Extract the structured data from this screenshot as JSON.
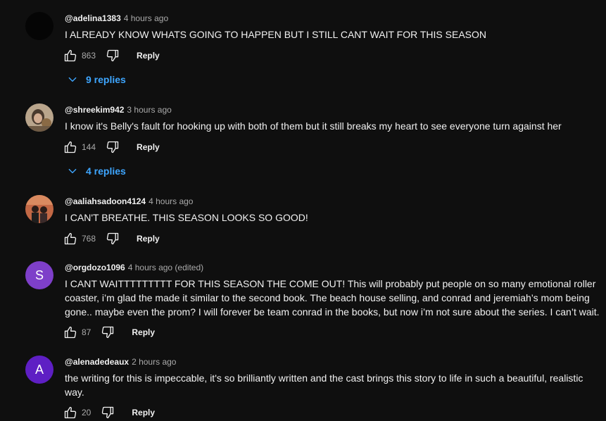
{
  "colors": {
    "background": "#0f0f0f",
    "link": "#3ea6ff",
    "muted": "#aaaaaa",
    "text": "#f1f1f1"
  },
  "icons": {
    "like": "thumbs-up-icon",
    "dislike": "thumbs-down-icon",
    "expand": "chevron-down-icon"
  },
  "comments": [
    {
      "author": "@adelina1383",
      "time": "4 hours ago",
      "text": "I ALREADY KNOW WHATS GOING TO HAPPEN BUT I STILL CANT WAIT FOR THIS SEASON",
      "likes": "863",
      "reply_label": "Reply",
      "replies_label": "9 replies",
      "avatar_color": "#050505"
    },
    {
      "author": "@shreekim942",
      "time": "3 hours ago",
      "text": "I know it's Belly's fault for hooking up with both of them but it still breaks my heart to see everyone turn against her",
      "likes": "144",
      "reply_label": "Reply",
      "replies_label": "4 replies",
      "avatar_color": "#b59a7f"
    },
    {
      "author": "@aaliahsadoon4124",
      "time": "4 hours ago",
      "text": "I CAN'T BREATHE. THIS SEASON LOOKS SO GOOD!",
      "likes": "768",
      "reply_label": "Reply",
      "avatar_color": "#c56a4a"
    },
    {
      "author": "@orgdozo1096",
      "time": "4 hours ago (edited)",
      "text": "I CANT WAITTTTTTTTT FOR THIS SEASON THE COME OUT! This will probably put people on so many emotional roller coaster, i’m glad the made it similar to the second book. The beach house selling, and conrad and jeremiah’s mom being gone.. maybe even the prom? I will forever be team conrad in the books, but now i’m not sure about the series. I can’t wait.",
      "likes": "87",
      "reply_label": "Reply",
      "avatar_letter": "S",
      "avatar_color": "#7e3fc9"
    },
    {
      "author": "@alenadedeaux",
      "time": "2 hours ago",
      "text": "the writing for this is impeccable, it's so brilliantly written and the cast brings this story to life in such a beautiful, realistic way.",
      "likes": "20",
      "reply_label": "Reply",
      "avatar_letter": "A",
      "avatar_color": "#5e1fc4"
    }
  ]
}
